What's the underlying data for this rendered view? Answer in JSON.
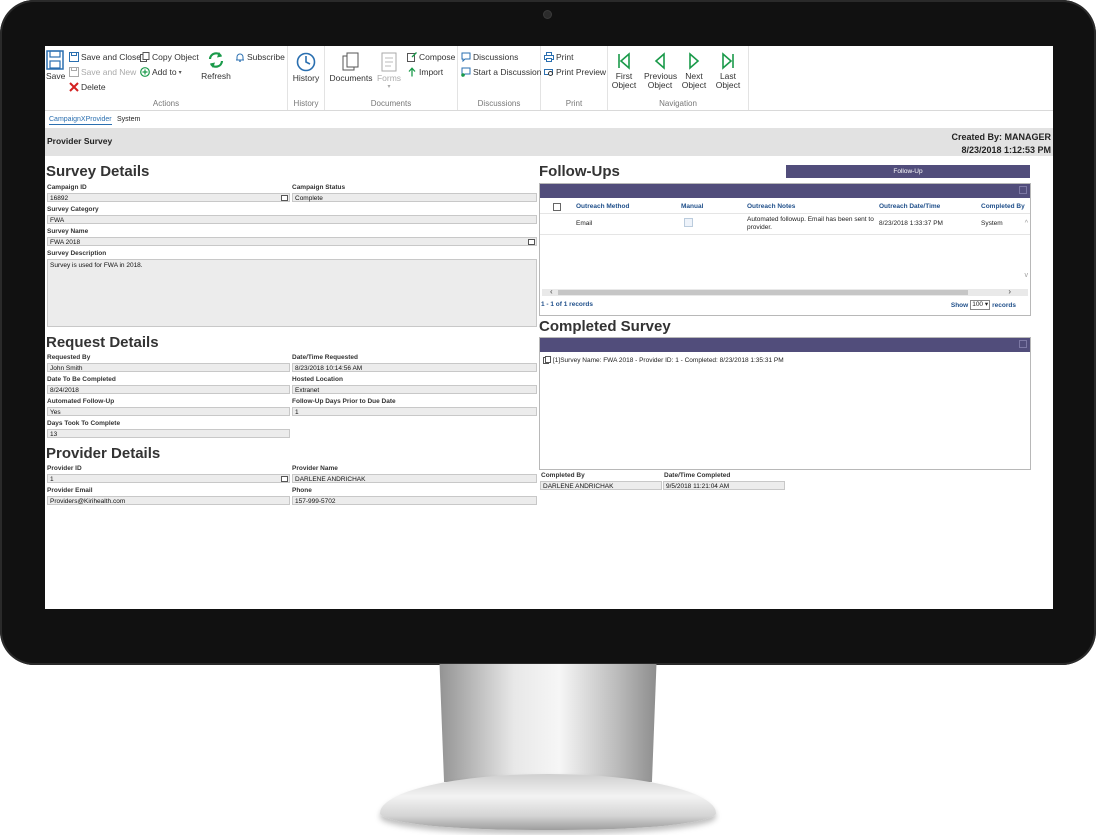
{
  "ribbon": {
    "actions": {
      "save": "Save",
      "save_close": "Save and Close",
      "save_new": "Save and New",
      "copy": "Copy Object",
      "add_to": "Add to",
      "delete": "Delete",
      "refresh": "Refresh",
      "subscribe": "Subscribe",
      "label": "Actions"
    },
    "history": {
      "history": "History",
      "label": "History"
    },
    "documents": {
      "documents": "Documents",
      "forms": "Forms",
      "compose": "Compose",
      "import": "Import",
      "label": "Documents"
    },
    "discussions": {
      "discussions": "Discussions",
      "start": "Start a Discussion",
      "label": "Discussions"
    },
    "print": {
      "print": "Print",
      "preview": "Print Preview",
      "label": "Print"
    },
    "navigation": {
      "first_a": "First",
      "first_b": "Object",
      "prev_a": "Previous",
      "prev_b": "Object",
      "next_a": "Next",
      "next_b": "Object",
      "last_a": "Last",
      "last_b": "Object",
      "label": "Navigation"
    },
    "accent": "#1a9a4a"
  },
  "tabs": [
    "CampaignXProvider",
    "System"
  ],
  "header": {
    "title": "Provider Survey",
    "created_by": "Created By: MANAGER",
    "created_at": "8/23/2018 1:12:53 PM"
  },
  "survey": {
    "heading": "Survey Details",
    "campaign_id_label": "Campaign ID",
    "campaign_id": "16892",
    "campaign_status_label": "Campaign Status",
    "campaign_status": "Complete",
    "category_label": "Survey Category",
    "category": "FWA",
    "name_label": "Survey Name",
    "name": "FWA 2018",
    "desc_label": "Survey Description",
    "desc": "Survey is used for FWA in 2018."
  },
  "request": {
    "heading": "Request Details",
    "requested_by_label": "Requested By",
    "requested_by": "John Smith",
    "requested_at_label": "Date/Time Requested",
    "requested_at": "8/23/2018 10:14:56 AM",
    "due_label": "Date To Be Completed",
    "due": "8/24/2018",
    "hosted_label": "Hosted Location",
    "hosted": "Extranet",
    "auto_label": "Automated Follow-Up",
    "auto": "Yes",
    "days_prior_label": "Follow-Up Days Prior to Due Date",
    "days_prior": "1",
    "days_took_label": "Days Took To Complete",
    "days_took": "13"
  },
  "provider": {
    "heading": "Provider Details",
    "id_label": "Provider ID",
    "id": "1",
    "name_label": "Provider Name",
    "name": "DARLENE ANDRICHAK",
    "email_label": "Provider Email",
    "email": "Providers@Kirihealth.com",
    "phone_label": "Phone",
    "phone": "157-999-5702"
  },
  "followups": {
    "heading": "Follow-Ups",
    "button": "Follow-Up",
    "columns": [
      "Outreach Method",
      "Manual",
      "Outreach Notes",
      "Outreach Date/Time",
      "Completed By"
    ],
    "row": {
      "method": "Email",
      "notes": "Automated followup. Email has been sent to provider.",
      "datetime": "8/23/2018 1:33:37 PM",
      "completed_by": "System"
    },
    "records": "1 - 1 of 1 records",
    "show": "Show",
    "page_size": "100",
    "records_suffix": "records"
  },
  "completed": {
    "heading": "Completed Survey",
    "item": "[1]Survey Name: FWA 2018 - Provider ID: 1 - Completed: 8/23/2018 1:35:31 PM",
    "by_label": "Completed By",
    "by": "DARLENE ANDRICHAK",
    "at_label": "Date/Time Completed",
    "at": "9/5/2018 11:21:04 AM"
  }
}
